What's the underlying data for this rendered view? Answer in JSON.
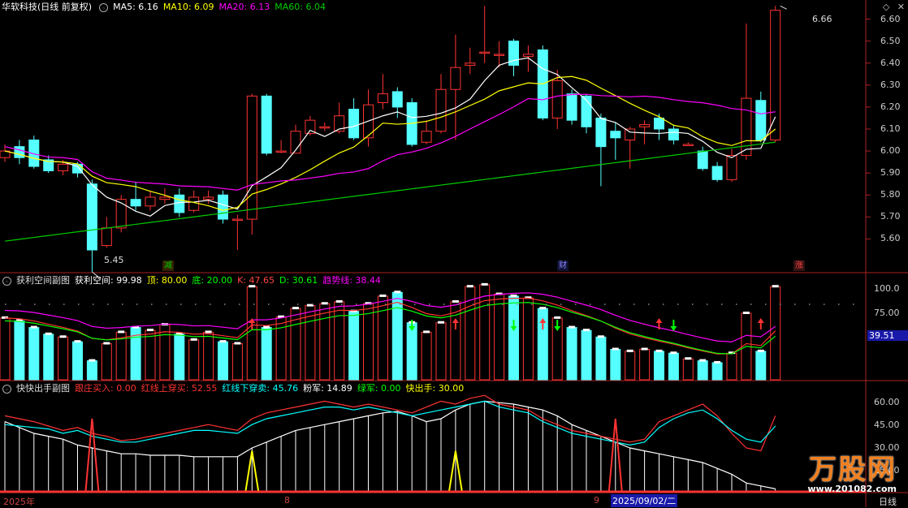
{
  "header": {
    "stock": "华软科技(日线 前复权)",
    "ma5": "MA5: 6.16",
    "ma10": "MA10: 6.09",
    "ma20": "MA20: 6.13",
    "ma60": "MA60: 6.04",
    "colors": {
      "ma5": "#ffffff",
      "ma10": "#ffff00",
      "ma20": "#ff00ff",
      "ma60": "#00cc00"
    }
  },
  "price_axis": [
    "6.60",
    "6.50",
    "6.40",
    "6.30",
    "6.20",
    "6.10",
    "6.00",
    "5.90",
    "5.80",
    "5.70",
    "5.60"
  ],
  "price_annotations": {
    "high": "6.66",
    "low": "5.45"
  },
  "event_badges": [
    {
      "text": "减",
      "color": "#00cc00"
    },
    {
      "text": "财",
      "color": "#8888ff"
    },
    {
      "text": "涨",
      "color": "#ff4444"
    }
  ],
  "panel2": {
    "title": "获利空间副图",
    "items": [
      {
        "label": "获利空间:",
        "value": "99.98",
        "color": "#ffffff"
      },
      {
        "label": "顶:",
        "value": "80.00",
        "color": "#ffff00"
      },
      {
        "label": "底:",
        "value": "20.00",
        "color": "#00ff00"
      },
      {
        "label": "K:",
        "value": "47.65",
        "color": "#ff4444"
      },
      {
        "label": "D:",
        "value": "30.61",
        "color": "#00ff00"
      },
      {
        "label": "趋势线:",
        "value": "38.44",
        "color": "#ff00ff"
      }
    ],
    "axis": [
      "100.0",
      "75.00"
    ],
    "current": "39.51"
  },
  "panel3": {
    "title": "快快出手副图",
    "items": [
      {
        "label": "跟庄买入:",
        "value": "0.00",
        "color": "#ff3333"
      },
      {
        "label": "红线上穿买:",
        "value": "52.55",
        "color": "#ff3333"
      },
      {
        "label": "红线下穿卖:",
        "value": "45.76",
        "color": "#00ffff"
      },
      {
        "label": "粉军:",
        "value": "14.89",
        "color": "#ffffff"
      },
      {
        "label": "绿军:",
        "value": "0.00",
        "color": "#00ff00"
      },
      {
        "label": "快出手:",
        "value": "30.00",
        "color": "#ffff00"
      }
    ],
    "axis": [
      "60.00",
      "45.00",
      "30.00",
      "15.00"
    ]
  },
  "x_axis": {
    "labels": [
      "2025年",
      "8",
      "9"
    ],
    "cursor_date": "2025/09/02/二",
    "period": "日线"
  },
  "watermark": {
    "title": "万股网",
    "url": "www.201082.com"
  },
  "chart_data": {
    "type": "candlestick",
    "candles": [
      [
        5.97,
        6.0,
        6.03,
        5.95
      ],
      [
        6.02,
        5.97,
        6.05,
        5.94
      ],
      [
        6.05,
        5.93,
        6.07,
        5.92
      ],
      [
        5.96,
        5.91,
        5.98,
        5.9
      ],
      [
        5.91,
        5.94,
        5.96,
        5.89
      ],
      [
        5.94,
        5.9,
        5.95,
        5.88
      ],
      [
        5.85,
        5.55,
        5.87,
        5.45
      ],
      [
        5.57,
        5.65,
        5.7,
        5.56
      ],
      [
        5.65,
        5.78,
        5.8,
        5.63
      ],
      [
        5.78,
        5.75,
        5.86,
        5.73
      ],
      [
        5.75,
        5.79,
        5.82,
        5.73
      ],
      [
        5.78,
        5.79,
        5.83,
        5.76
      ],
      [
        5.8,
        5.72,
        5.83,
        5.7
      ],
      [
        5.73,
        5.79,
        5.82,
        5.72
      ],
      [
        5.78,
        5.79,
        5.82,
        5.76
      ],
      [
        5.8,
        5.69,
        5.82,
        5.67
      ],
      [
        5.69,
        5.69,
        5.71,
        5.55
      ],
      [
        5.69,
        6.25,
        6.26,
        5.62
      ],
      [
        6.25,
        5.99,
        6.26,
        5.98
      ],
      [
        6.0,
        6.0,
        6.05,
        5.99
      ],
      [
        5.99,
        6.09,
        6.12,
        5.99
      ],
      [
        6.08,
        6.14,
        6.16,
        6.07
      ],
      [
        6.11,
        6.11,
        6.13,
        6.09
      ],
      [
        6.09,
        6.16,
        6.22,
        6.08
      ],
      [
        6.19,
        6.06,
        6.24,
        6.05
      ],
      [
        6.06,
        6.21,
        6.28,
        6.02
      ],
      [
        6.22,
        6.26,
        6.35,
        6.19
      ],
      [
        6.27,
        6.2,
        6.29,
        6.15
      ],
      [
        6.22,
        6.03,
        6.24,
        6.02
      ],
      [
        6.04,
        6.09,
        6.14,
        6.03
      ],
      [
        6.09,
        6.28,
        6.35,
        6.08
      ],
      [
        6.28,
        6.38,
        6.53,
        6.05
      ],
      [
        6.39,
        6.4,
        6.47,
        6.35
      ],
      [
        6.45,
        6.45,
        6.66,
        6.4
      ],
      [
        6.44,
        6.44,
        6.5,
        6.38
      ],
      [
        6.5,
        6.39,
        6.51,
        6.34
      ],
      [
        6.43,
        6.44,
        6.48,
        6.36
      ],
      [
        6.46,
        6.15,
        6.48,
        6.14
      ],
      [
        6.15,
        6.32,
        6.37,
        6.1
      ],
      [
        6.26,
        6.14,
        6.28,
        6.12
      ],
      [
        6.25,
        6.11,
        6.26,
        6.08
      ],
      [
        6.15,
        6.02,
        6.17,
        5.84
      ],
      [
        6.09,
        6.06,
        6.13,
        5.96
      ],
      [
        6.05,
        6.1,
        6.11,
        5.92
      ],
      [
        6.11,
        6.12,
        6.14,
        6.03
      ],
      [
        6.15,
        6.1,
        6.17,
        6.05
      ],
      [
        6.1,
        6.05,
        6.12,
        6.03
      ],
      [
        6.03,
        6.03,
        6.04,
        6.03
      ],
      [
        6.0,
        5.92,
        6.02,
        5.91
      ],
      [
        5.93,
        5.87,
        5.95,
        5.86
      ],
      [
        5.87,
        5.98,
        6.01,
        5.86
      ],
      [
        5.98,
        6.24,
        6.58,
        5.96
      ],
      [
        6.23,
        6.05,
        6.27,
        6.04
      ],
      [
        6.05,
        6.64,
        6.66,
        6.04
      ]
    ]
  }
}
